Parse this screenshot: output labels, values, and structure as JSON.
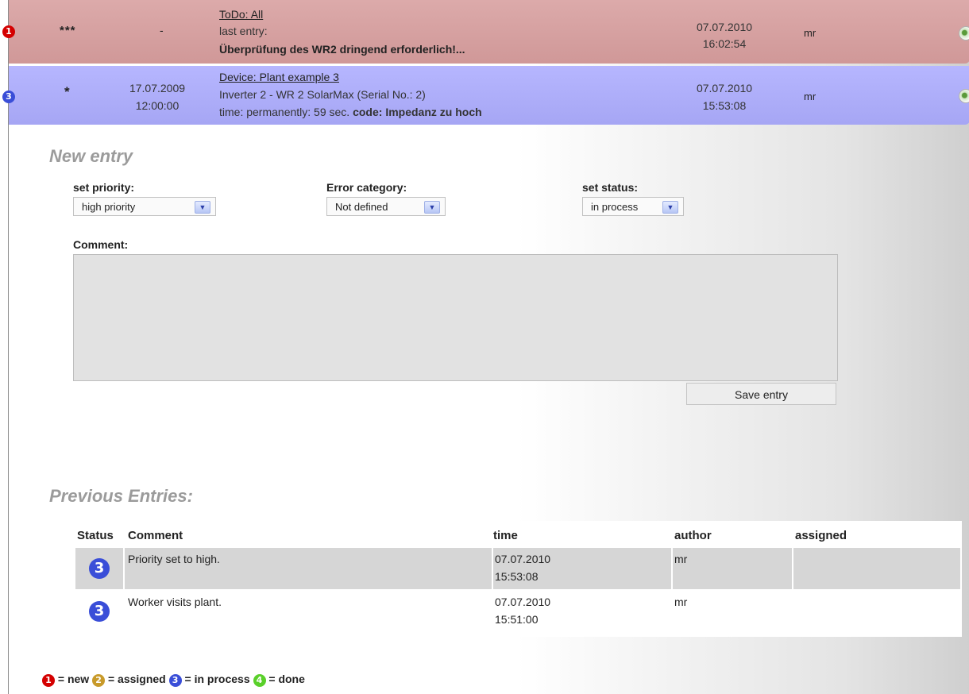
{
  "todo_row": {
    "status_number": "1",
    "priority": "***",
    "date": "-",
    "title_link": "ToDo: All",
    "line2": "last entry:",
    "line3": "Überprüfung des WR2 dringend erforderlich!...",
    "time_date": "07.07.2010",
    "time_clock": "16:02:54",
    "author": "mr"
  },
  "device_row": {
    "status_number": "3",
    "priority": "*",
    "date": "17.07.2009",
    "clock": "12:00:00",
    "title_link": "Device: Plant example 3",
    "line2": "Inverter 2 - WR 2 SolarMax (Serial No.: 2)",
    "line3_prefix": "time:  permanently: 59 sec.",
    "line3_code_label": "code:",
    "line3_code_value": "Impedanz zu hoch",
    "time_date": "07.07.2010",
    "time_clock": "15:53:08",
    "author": "mr"
  },
  "new_entry": {
    "title": "New entry",
    "priority_label": "set priority:",
    "priority_value": "high priority",
    "category_label": "Error category:",
    "category_value": "Not defined",
    "status_label": "set status:",
    "status_value": "in process",
    "comment_label": "Comment:",
    "comment_value": "",
    "save_label": "Save entry"
  },
  "previous": {
    "title": "Previous Entries:",
    "headers": {
      "status": "Status",
      "comment": "Comment",
      "time": "time",
      "author": "author",
      "assigned": "assigned"
    },
    "rows": [
      {
        "status": "3",
        "comment": "Priority set to high.",
        "date": "07.07.2010",
        "clock": "15:53:08",
        "author": "mr",
        "assigned": ""
      },
      {
        "status": "3",
        "comment": "Worker visits plant.",
        "date": "07.07.2010",
        "clock": "15:51:00",
        "author": "mr",
        "assigned": ""
      }
    ]
  },
  "legend": {
    "n1": "1",
    "l1": "= new",
    "n2": "2",
    "l2": "= assigned",
    "n3": "3",
    "l3": "= in process",
    "n4": "4",
    "l4": "= done"
  },
  "colors": {
    "new": "#d40000",
    "assigned": "#c89a2a",
    "in_process": "#3a4ed8",
    "done": "#5ad02a",
    "row_new_bg": "#d09898",
    "row_in_process_bg": "#a6a6f4"
  }
}
